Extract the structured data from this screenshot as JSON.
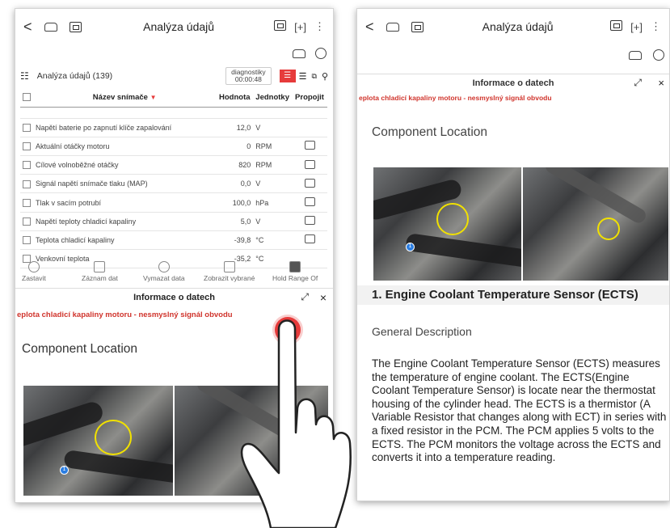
{
  "left": {
    "topbar": {
      "back": "<",
      "title": "Analýza údajů",
      "more": "⋮"
    },
    "list_header": {
      "title": "Analýza údajů (139)",
      "diag_label": "diagnostiky",
      "timer": "00:00:48"
    },
    "table": {
      "headers": [
        "Název snímače",
        "Hodnota",
        "Jednotky",
        "Propojit"
      ],
      "rows": [
        {
          "name": "Napětí baterie po zapnutí klíče zapalování",
          "value": "12,0",
          "unit": "V"
        },
        {
          "name": "Aktuální otáčky motoru",
          "value": "0",
          "unit": "RPM"
        },
        {
          "name": "Cílové volnoběžné otáčky",
          "value": "820",
          "unit": "RPM"
        },
        {
          "name": "Signál napětí snímače tlaku (MAP)",
          "value": "0,0",
          "unit": "V"
        },
        {
          "name": "Tlak v sacím potrubí",
          "value": "100,0",
          "unit": "hPa"
        },
        {
          "name": "Napětí teploty chladicí kapaliny",
          "value": "5,0",
          "unit": "V"
        },
        {
          "name": "Teplota chladicí kapaliny",
          "value": "-39,8",
          "unit": "°C"
        },
        {
          "name": "Venkovní teplota",
          "value": "-35,2",
          "unit": "°C"
        }
      ]
    },
    "tools": [
      "Zastavit",
      "Záznam dat",
      "Vymazat data",
      "Zobrazit vybrané",
      "Hold Range Of"
    ],
    "info": {
      "title": "Informace o datech",
      "error": "eplota chladicí kapaliny motoru - nesmyslný signál obvodu",
      "section": "Component Location",
      "marker": "1"
    }
  },
  "right": {
    "topbar": {
      "back": "<",
      "title": "Analýza údajů",
      "more": "⋮"
    },
    "info": {
      "title": "Informace o datech",
      "error": "eplota chladicí kapaliny motoru - nesmyslný signál obvodu",
      "section": "Component Location",
      "marker": "1",
      "heading": "1. Engine Coolant Temperature Sensor (ECTS)",
      "general": "General Description",
      "body": "The Engine Coolant Temperature Sensor (ECTS) measures the temperature of engine coolant. The ECTS(Engine Coolant Temperature Sensor) is locate near the thermostat housing of the cylinder head. The ECTS is a thermistor (A Variable Resistor that changes along with ECT) in series with a fixed resistor in the PCM. The PCM applies 5 volts to the ECTS. The PCM monitors the voltage across the ECTS and converts it into a temperature reading."
    }
  },
  "colors": {
    "accent": "#e63b3b",
    "error_text": "#d0342c",
    "highlight_ring": "#f1e100"
  }
}
